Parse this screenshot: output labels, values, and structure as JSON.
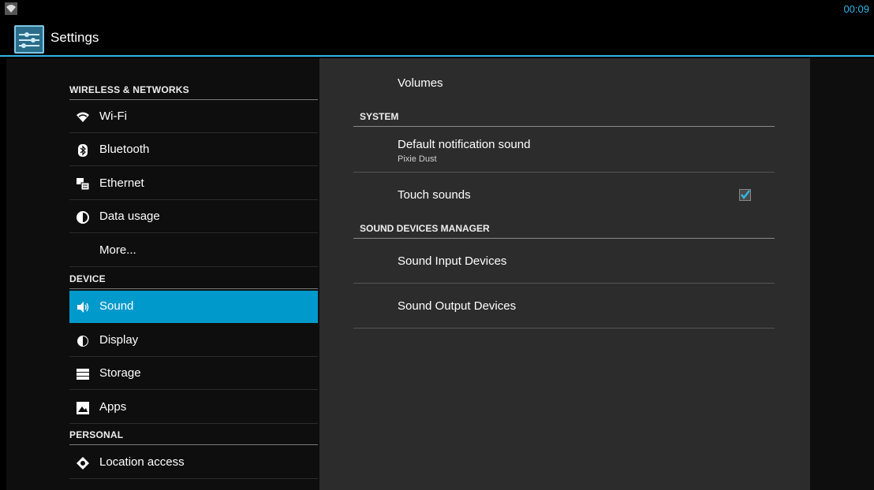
{
  "status": {
    "time": "00:09",
    "wifi_icon": "wifi-icon"
  },
  "app": {
    "title": "Settings",
    "icon": "settings-sliders-icon"
  },
  "left": {
    "categories": [
      "WIRELESS & NETWORKS",
      "DEVICE",
      "PERSONAL"
    ],
    "items": [
      {
        "label": "Wi-Fi",
        "icon": "wifi-icon"
      },
      {
        "label": "Bluetooth",
        "icon": "bluetooth-icon"
      },
      {
        "label": "Ethernet",
        "icon": "ethernet-icon"
      },
      {
        "label": "Data usage",
        "icon": "data-usage-icon"
      },
      {
        "label": "More...",
        "icon": ""
      },
      {
        "label": "Sound",
        "icon": "speaker-icon",
        "selected": true
      },
      {
        "label": "Display",
        "icon": "brightness-icon"
      },
      {
        "label": "Storage",
        "icon": "storage-icon"
      },
      {
        "label": "Apps",
        "icon": "apps-icon"
      },
      {
        "label": "Location access",
        "icon": "location-icon"
      }
    ]
  },
  "right": {
    "volumes": "Volumes",
    "system_header": "SYSTEM",
    "notification_title": "Default notification sound",
    "notification_value": "Pixie Dust",
    "touch_sounds": "Touch sounds",
    "touch_sounds_checked": true,
    "devices_header": "SOUND DEVICES MANAGER",
    "input_devices": "Sound Input Devices",
    "output_devices": "Sound Output Devices"
  },
  "colors": {
    "accent": "#33b5e5",
    "selected": "#0099cc"
  }
}
